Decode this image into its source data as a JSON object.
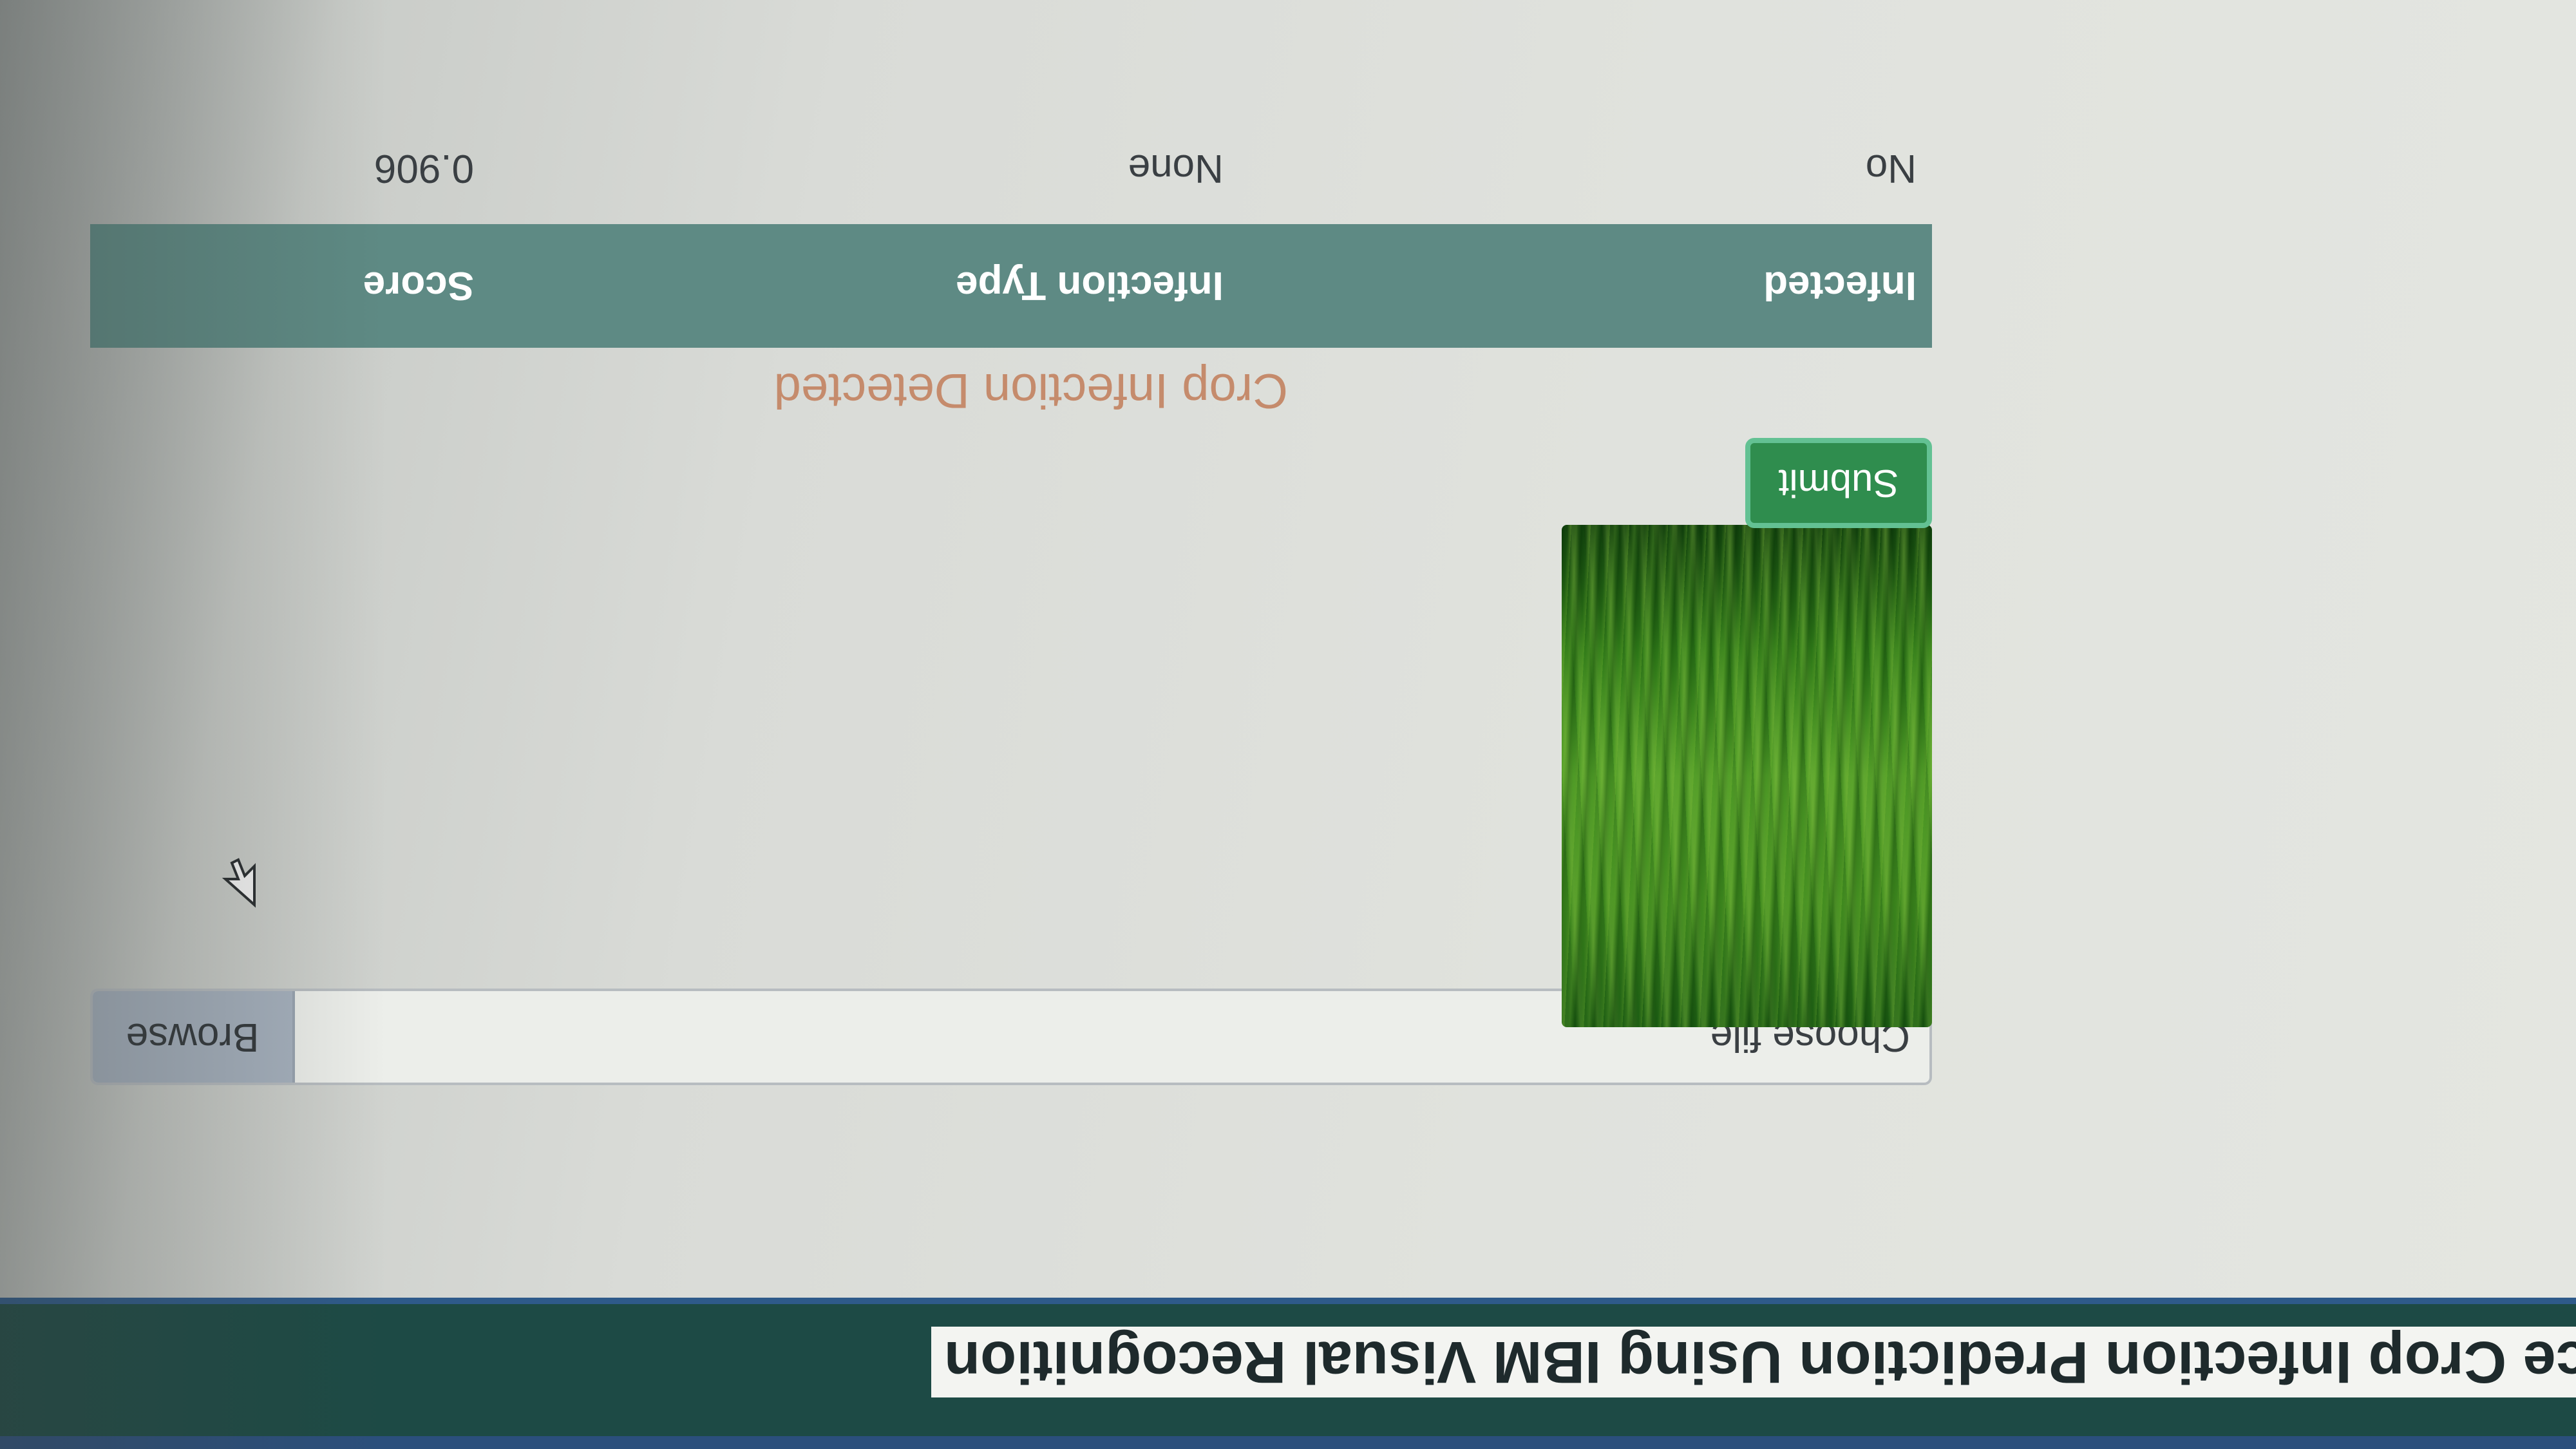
{
  "app": {
    "title": "ce Crop Infection Prediction Using IBM Visual Recognition"
  },
  "upload": {
    "file_label": "Choose file",
    "browse_label": "Browse",
    "preview_image_icon": "crop-leaf-image"
  },
  "form": {
    "submit_label": "Submit"
  },
  "result": {
    "heading": "Crop Infection Detected",
    "columns": [
      "Infected",
      "Infection Type",
      "Score"
    ],
    "rows": [
      [
        "No",
        "None",
        "0.906"
      ]
    ]
  },
  "colors": {
    "navbar": "#1d4a45",
    "table_header": "#5e8a84",
    "submit": "#2f8d4e",
    "heading_text": "#c58b6c",
    "browse": "#a6b1be"
  },
  "icons": {
    "cursor": "mouse-pointer-icon"
  }
}
